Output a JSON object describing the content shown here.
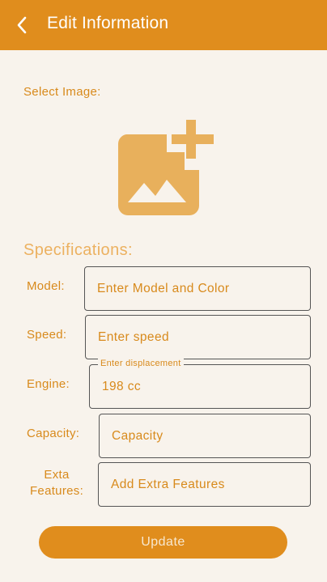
{
  "appbar": {
    "title": "Edit Information",
    "back_icon": "arrow-back-icon",
    "background": "#e08d1d"
  },
  "image_section": {
    "label": "Select Image:",
    "icon": "add-photo-icon",
    "icon_color": "#e8b05c"
  },
  "specifications": {
    "heading": "Specifications:",
    "fields": {
      "model": {
        "label": "Model:",
        "placeholder": "Enter Model and Color"
      },
      "speed": {
        "label": "Speed:",
        "placeholder": "Enter speed"
      },
      "engine": {
        "label": "Engine:",
        "floating_label": "Enter displacement",
        "value": "198 cc"
      },
      "capacity": {
        "label": "Capacity:",
        "placeholder": "Capacity"
      },
      "extra": {
        "label_line1": "Exta",
        "label_line2": "Features:",
        "placeholder": "Add Extra Features"
      }
    }
  },
  "update_button": {
    "label": "Update"
  },
  "colors": {
    "accent": "#e08d1d",
    "background": "#f8f3ec",
    "text": "#d88a1c"
  }
}
